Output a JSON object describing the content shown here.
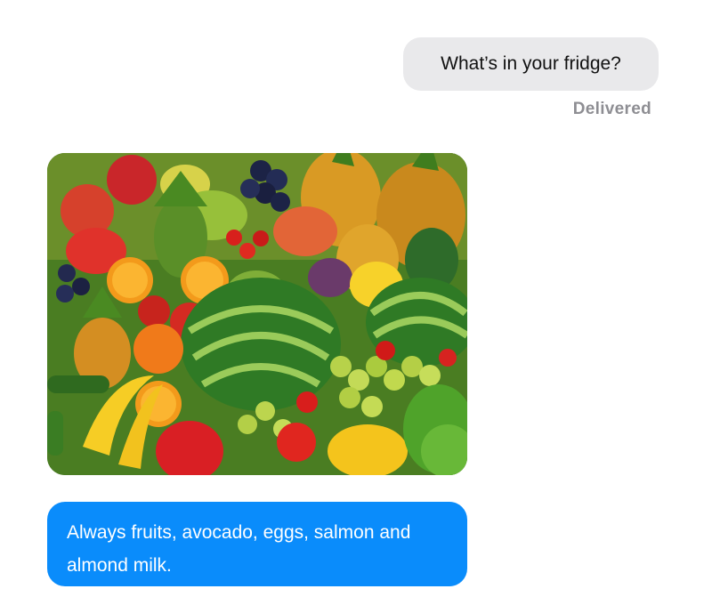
{
  "messages": [
    {
      "direction": "outgoing",
      "text": "What’s in your fridge?",
      "status": "Delivered"
    },
    {
      "direction": "incoming",
      "type": "image",
      "image_description": "fruits-and-vegetables-photo"
    },
    {
      "direction": "incoming",
      "text": "Always fruits, avocado, eggs, salmon and almond milk."
    }
  ],
  "colors": {
    "outgoing_bubble": "#e9e9eb",
    "incoming_bubble": "#0a8cfb",
    "status_text": "#8e8e93"
  }
}
